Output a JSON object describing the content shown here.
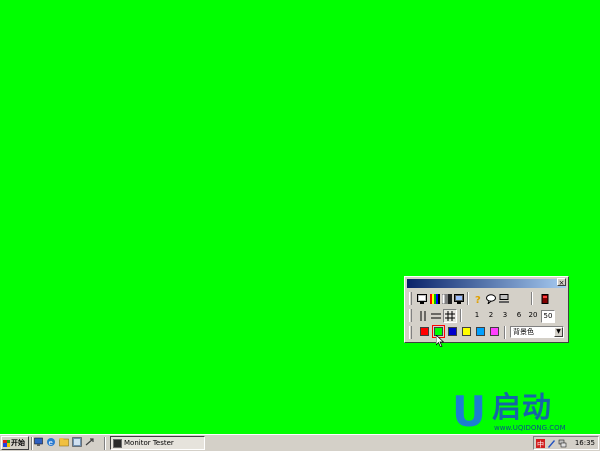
{
  "window": {
    "title": "",
    "close_glyph": "×"
  },
  "toolbar": {
    "row1_icons": [
      "display-icon",
      "color-bars-icon",
      "grayscale-icon",
      "monitor-icon",
      "help-icon",
      "chat-icon",
      "network-icon",
      "exit-icon"
    ],
    "row2_icons": [
      "vertical-lines-icon",
      "horizontal-lines-icon",
      "grid-icon"
    ],
    "line_widths": [
      "1",
      "2",
      "3",
      "6",
      "20",
      "50"
    ],
    "selected_line_width": "50",
    "colors": [
      "#ff0000",
      "#00ff00",
      "#0000cc",
      "#ffff00",
      "#00a0ff",
      "#ff40ff"
    ],
    "selected_color": "#00ff00",
    "combo_value": "背景色"
  },
  "watermark": {
    "logo_letter": "U",
    "logo_text": "启动",
    "url": "www.UQIDONG.COM"
  },
  "taskbar": {
    "start_label": "开始",
    "quicklaunch_icons": [
      "ie-icon",
      "outlook-icon",
      "folder-icon",
      "media-icon",
      "arrow-icon"
    ],
    "tasks": [
      {
        "label": "Monitor Tester"
      }
    ],
    "tray_icons": [
      "chinese-ime-icon",
      "pen-icon",
      "network-tray-icon"
    ],
    "clock": "16:35"
  }
}
